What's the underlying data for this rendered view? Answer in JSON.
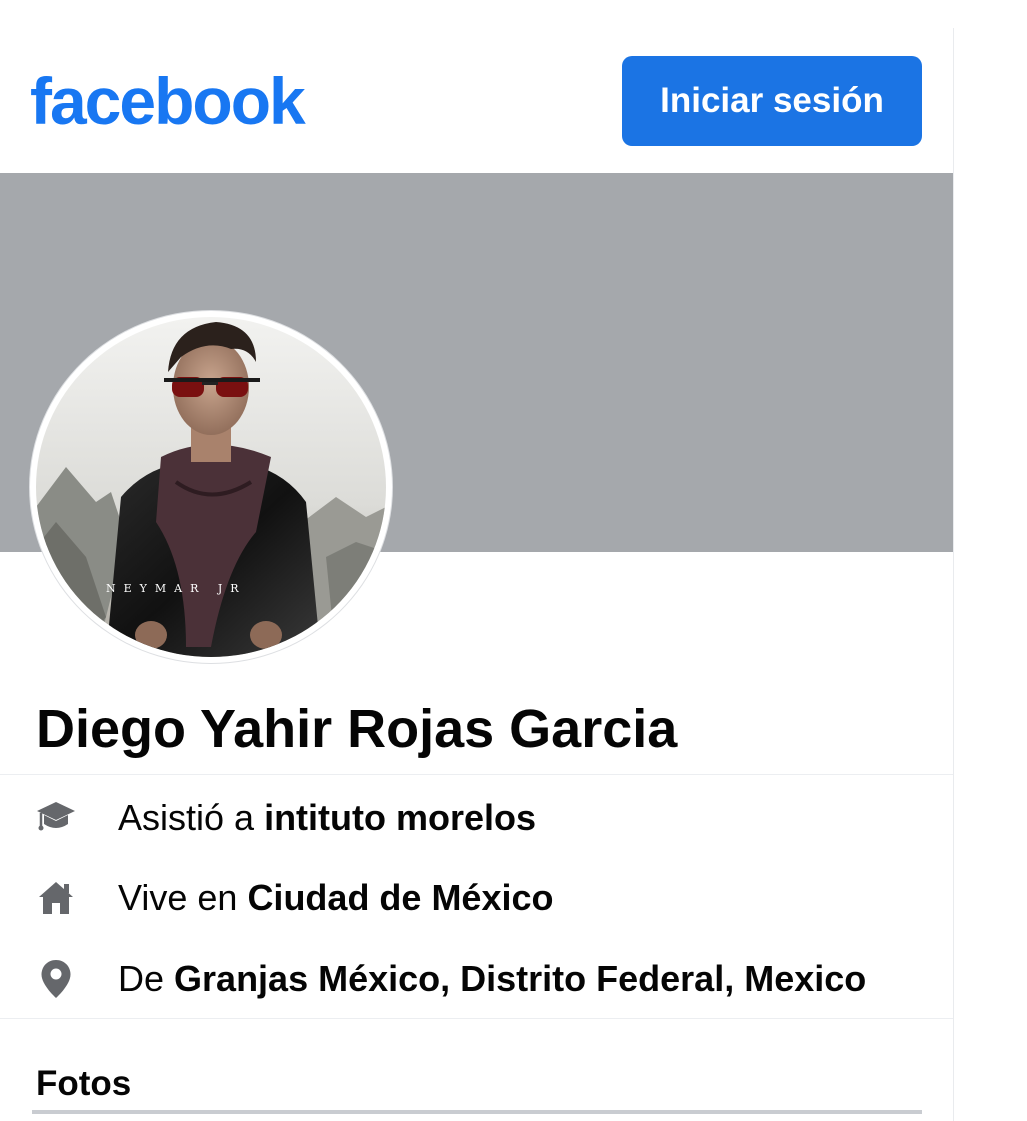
{
  "header": {
    "logo_text": "facebook",
    "login_label": "Iniciar sesión",
    "brand_color": "#1877f2",
    "button_color": "#1b74e4"
  },
  "cover": {
    "color": "#a5a8ac"
  },
  "profile": {
    "name": "Diego Yahir Rojas Garcia",
    "avatar_watermark": "NEYMAR JR"
  },
  "info": [
    {
      "icon": "graduation-cap-icon",
      "prefix": "Asistió a ",
      "value": "intituto morelos"
    },
    {
      "icon": "home-icon",
      "prefix": "Vive en ",
      "value": "Ciudad de México"
    },
    {
      "icon": "location-pin-icon",
      "prefix": "De ",
      "value": "Granjas México, Distrito Federal, Mexico"
    }
  ],
  "sections": {
    "photos_title": "Fotos"
  },
  "colors": {
    "icon_gray": "#65676b",
    "text": "#050505"
  }
}
